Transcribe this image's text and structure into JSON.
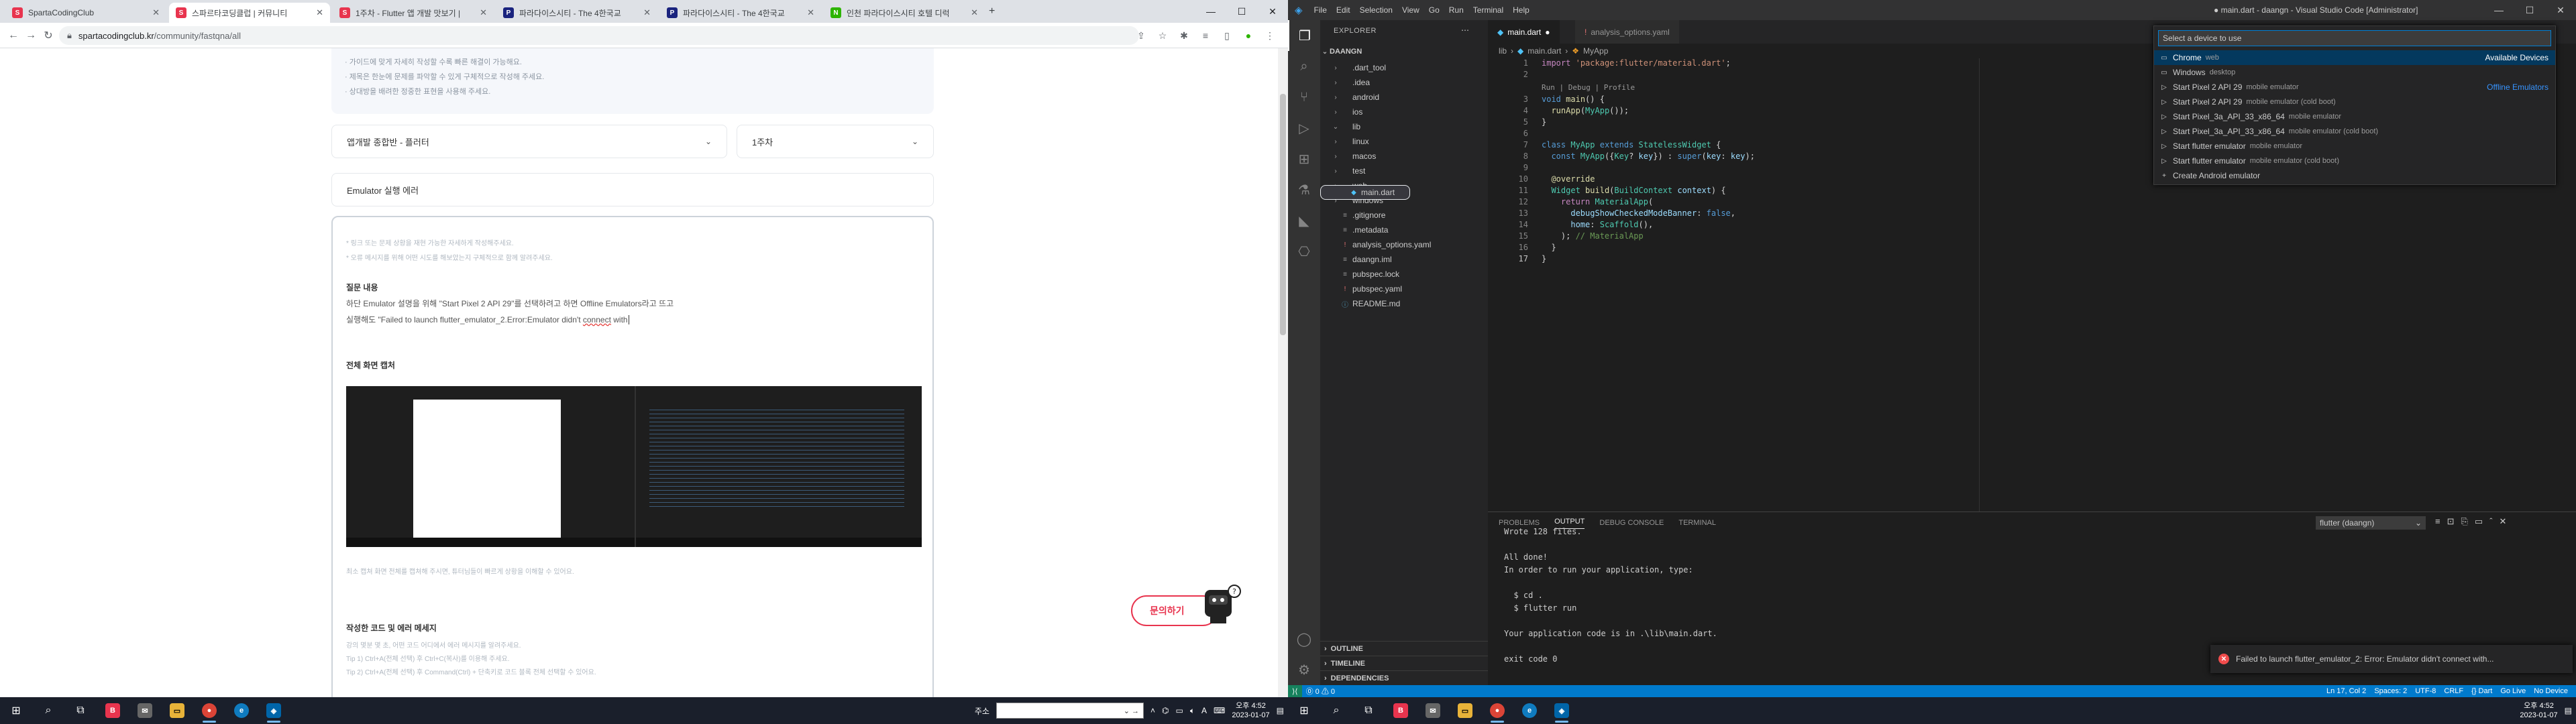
{
  "browser": {
    "tabs": [
      {
        "title": "SpartaCodingClub",
        "fav_color": "#e8344e",
        "fav_glyph": "S"
      },
      {
        "title": "스파르타코딩클럽 | 커뮤니티",
        "fav_color": "#e8344e",
        "fav_glyph": "S"
      },
      {
        "title": "1주차 - Flutter 앱 개발 맛보기 |",
        "fav_color": "#e8344e",
        "fav_glyph": "S"
      },
      {
        "title": "파라다이스시티 - The 4한국교",
        "fav_color": "#1a237e",
        "fav_glyph": "P"
      },
      {
        "title": "파라다이스시티 - The 4한국교",
        "fav_color": "#1a237e",
        "fav_glyph": "P"
      },
      {
        "title": "인천 파라다이스시티 호텔 디럭",
        "fav_color": "#2db400",
        "fav_glyph": "N"
      }
    ],
    "url_domain": "spartacodingclub.kr",
    "url_path": "/community/fastqna/all"
  },
  "page": {
    "guide_lines": [
      "· 가이드에 맞게 자세히 작성할 수록 빠른 해결이 가능해요.",
      "· 제목은 한눈에 문제를 파악할 수 있게 구체적으로 작성해 주세요.",
      "· 상대방을 배려한 정중한 표현을 사용해 주세요."
    ],
    "course_select": "앱개발 종합반 - 플러터",
    "week_select": "1주차",
    "title_value": "Emulator 실행 에러",
    "hint1": "* 링크 또는 문제 상황을 재현 가능한 자세하게 작성해주세요.",
    "hint2": "* 오류 메시지를 위해 어떤 시도를 해보았는지 구체적으로 함께 알려주세요.",
    "q_heading": "질문 내용",
    "q_line1": "하단 Emulator 설명을 위해 \"Start Pixel 2 API 29\"를 선택하려고 하면 Offline Emulators라고 뜨고",
    "q_line2_a": "실행해도 \"Failed to launch flutter_emulator_2.Error:Emulator didn't ",
    "q_line2_b": "connect",
    "q_line2_c": " with",
    "screen_heading": "전체 화면 캡처",
    "screen_hint": "최소 캡쳐 화면 전체를 캡쳐해 주시면, 튜터님들이 빠르게 상황을 이해할 수 있어요.",
    "code_heading": "작성한 코드 및 에러 메세지",
    "code_hint1": "강의 몇분 몇 초, 어떤 코드 어디에서 에러 메시지를 알려주세요.",
    "code_hint2": "Tip 1) Ctrl+A(전체 선택) 후 Ctrl+C(복사)를 이용해 주세요.",
    "code_hint3": "Tip 2) Ctrl+A(전체 선택) 후 Command(Ctrl) + 단축키로 코드 블록 전체 선택할 수 있어요.",
    "fab_label": "문의하기"
  },
  "vscode": {
    "menu": [
      "File",
      "Edit",
      "Selection",
      "View",
      "Go",
      "Run",
      "Terminal",
      "Help"
    ],
    "window_title": "● main.dart - daangn - Visual Studio Code [Administrator]",
    "explorer_label": "EXPLORER",
    "project": "DAANGN",
    "tree": [
      {
        "name": ".dart_tool",
        "kind": "folder",
        "depth": 1
      },
      {
        "name": ".idea",
        "kind": "folder",
        "depth": 1
      },
      {
        "name": "android",
        "kind": "folder",
        "depth": 1
      },
      {
        "name": "ios",
        "kind": "folder",
        "depth": 1
      },
      {
        "name": "lib",
        "kind": "folder-open",
        "depth": 1
      },
      {
        "name": "main.dart",
        "kind": "dart",
        "depth": 2
      },
      {
        "name": "linux",
        "kind": "folder",
        "depth": 1
      },
      {
        "name": "macos",
        "kind": "folder",
        "depth": 1
      },
      {
        "name": "test",
        "kind": "folder",
        "depth": 1
      },
      {
        "name": "web",
        "kind": "folder",
        "depth": 1
      },
      {
        "name": "windows",
        "kind": "folder",
        "depth": 1
      },
      {
        "name": ".gitignore",
        "kind": "file",
        "depth": 1
      },
      {
        "name": ".metadata",
        "kind": "file",
        "depth": 1
      },
      {
        "name": "analysis_options.yaml",
        "kind": "yaml",
        "depth": 1
      },
      {
        "name": "daangn.iml",
        "kind": "file",
        "depth": 1
      },
      {
        "name": "pubspec.lock",
        "kind": "file",
        "depth": 1
      },
      {
        "name": "pubspec.yaml",
        "kind": "yaml",
        "depth": 1
      },
      {
        "name": "README.md",
        "kind": "md",
        "depth": 1
      }
    ],
    "sidebar_footer": [
      "OUTLINE",
      "TIMELINE",
      "DEPENDENCIES"
    ],
    "tabs": [
      "main.dart",
      "analysis_options.yaml"
    ],
    "breadcrumb": [
      "lib",
      "main.dart",
      "MyApp"
    ],
    "code_lens": "Run | Debug | Profile",
    "quick_pick": {
      "placeholder": "Select a device to use",
      "rows": [
        {
          "name": "Chrome",
          "desc": "web",
          "group": "Available Devices"
        },
        {
          "name": "Windows",
          "desc": "desktop",
          "group": ""
        },
        {
          "name": "Start Pixel 2 API 29",
          "desc": "mobile emulator",
          "group": "Offline Emulators"
        },
        {
          "name": "Start Pixel 2 API 29",
          "desc": "mobile emulator (cold boot)",
          "group": ""
        },
        {
          "name": "Start Pixel_3a_API_33_x86_64",
          "desc": "mobile emulator",
          "group": ""
        },
        {
          "name": "Start Pixel_3a_API_33_x86_64",
          "desc": "mobile emulator (cold boot)",
          "group": ""
        },
        {
          "name": "Start flutter emulator",
          "desc": "mobile emulator",
          "group": ""
        },
        {
          "name": "Start flutter emulator",
          "desc": "mobile emulator (cold boot)",
          "group": ""
        },
        {
          "name": "Create Android emulator",
          "desc": "",
          "group": ""
        }
      ]
    },
    "panel_tabs": [
      "PROBLEMS",
      "OUTPUT",
      "DEBUG CONSOLE",
      "TERMINAL"
    ],
    "output_channel": "flutter (daangn)",
    "output_lines": [
      "Wrote 128 files.",
      "",
      "All done!",
      "In order to run your application, type:",
      "",
      "  $ cd .",
      "  $ flutter run",
      "",
      "Your application code is in .\\lib\\main.dart.",
      "",
      "exit code 0"
    ],
    "toast": "Failed to launch flutter_emulator_2: Error: Emulator didn't connect with...",
    "status_left": [
      "⓪ 0 ⚠ 0"
    ],
    "status_right": [
      "Ln 17, Col 2",
      "Spaces: 2",
      "UTF-8",
      "CRLF",
      "{} Dart",
      "Go Live",
      "No Device"
    ]
  },
  "taskbar": {
    "search_label": "주소",
    "time": "오후 4:52",
    "date": "2023-01-07",
    "ime": "A"
  },
  "colors": {
    "brand": "#e8344e",
    "vscode_status": "#007acc"
  }
}
